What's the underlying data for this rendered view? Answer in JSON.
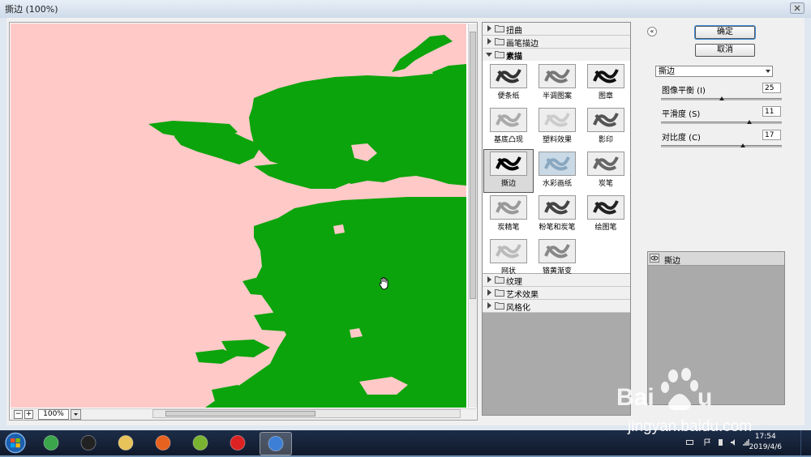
{
  "window": {
    "title": "撕边 (100%)"
  },
  "preview": {
    "zoom_value": "100%",
    "zoom_out_label": "−",
    "zoom_in_label": "+",
    "colors": {
      "background": "#ffc9c8",
      "shape": "#0ca40c"
    }
  },
  "gallery": {
    "categories_top": [
      {
        "label": "扭曲",
        "expanded": false
      },
      {
        "label": "画笔描边",
        "expanded": false
      },
      {
        "label": "素描",
        "expanded": true
      }
    ],
    "filters": [
      {
        "label": "便条纸",
        "icon": "note-paper-thumb"
      },
      {
        "label": "半调图案",
        "icon": "halftone-thumb"
      },
      {
        "label": "图章",
        "icon": "stamp-thumb"
      },
      {
        "label": "基底凸现",
        "icon": "bas-relief-thumb"
      },
      {
        "label": "塑料效果",
        "icon": "plaster-thumb"
      },
      {
        "label": "影印",
        "icon": "photocopy-thumb"
      },
      {
        "label": "撕边",
        "icon": "torn-edges-thumb",
        "selected": true
      },
      {
        "label": "水彩画纸",
        "icon": "water-paper-thumb"
      },
      {
        "label": "炭笔",
        "icon": "charcoal-thumb"
      },
      {
        "label": "炭精笔",
        "icon": "conte-crayon-thumb"
      },
      {
        "label": "粉笔和炭笔",
        "icon": "chalk-charcoal-thumb"
      },
      {
        "label": "绘图笔",
        "icon": "graphic-pen-thumb"
      },
      {
        "label": "网状",
        "icon": "reticulation-thumb"
      },
      {
        "label": "铬黄渐变",
        "icon": "chrome-thumb"
      }
    ],
    "categories_bottom": [
      {
        "label": "纹理"
      },
      {
        "label": "艺术效果"
      },
      {
        "label": "风格化"
      }
    ]
  },
  "settings": {
    "ok_label": "确定",
    "cancel_label": "取消",
    "collapse_label": "«",
    "selected_filter": "撕边",
    "params": [
      {
        "label": "图像平衡 (I)",
        "value": "25",
        "fraction": 0.5
      },
      {
        "label": "平滑度 (S)",
        "value": "11",
        "fraction": 0.73
      },
      {
        "label": "对比度 (C)",
        "value": "17",
        "fraction": 0.68
      }
    ],
    "layer": {
      "label": "撕边"
    }
  },
  "taskbar": {
    "time": "17:54",
    "date": "2019/4/6",
    "apps": [
      "refresh-app-icon",
      "qq-icon",
      "file-explorer-icon",
      "firefox-icon",
      "media-player-icon",
      "record-icon",
      "feather-app-icon"
    ]
  },
  "watermark": {
    "text": "jingyan.baidu.com",
    "logo": "baidu-paw-logo"
  }
}
